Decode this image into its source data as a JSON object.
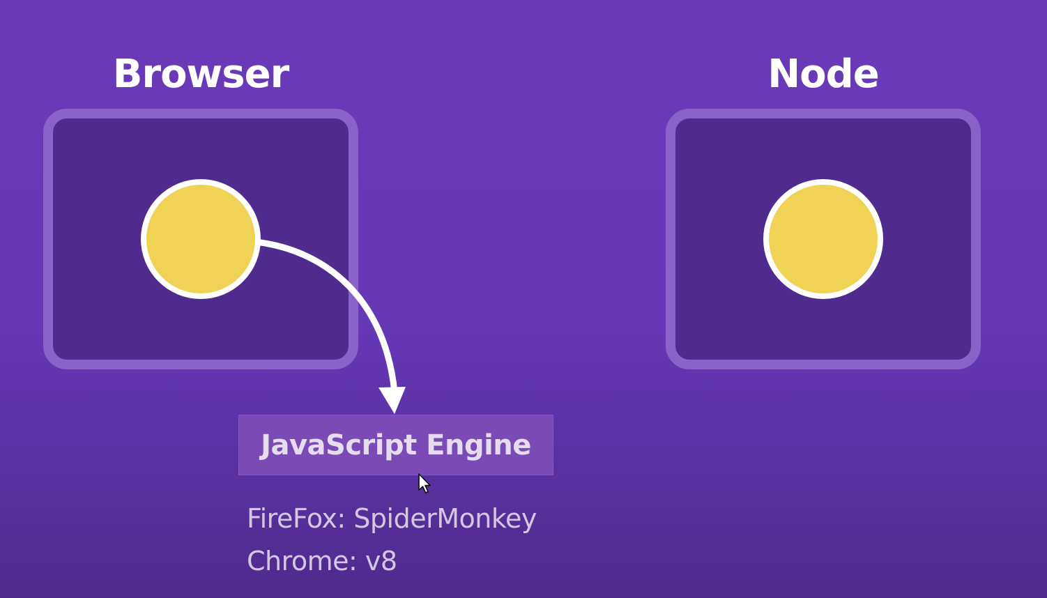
{
  "diagram": {
    "left_title": "Browser",
    "right_title": "Node",
    "engine_label": "JavaScript Engine",
    "engines": [
      "FireFox: SpiderMonkey",
      "Chrome: v8"
    ]
  },
  "colors": {
    "background": "#6a3bb9",
    "panel_fill": "#4e2b8c",
    "panel_border": "#8a63c9",
    "dot_fill": "#f0d257",
    "dot_border": "#ffffff",
    "engine_box": "#7b4bb5",
    "text_light": "#d3c7e4"
  },
  "icons": {
    "cursor": "mouse-pointer-icon"
  }
}
